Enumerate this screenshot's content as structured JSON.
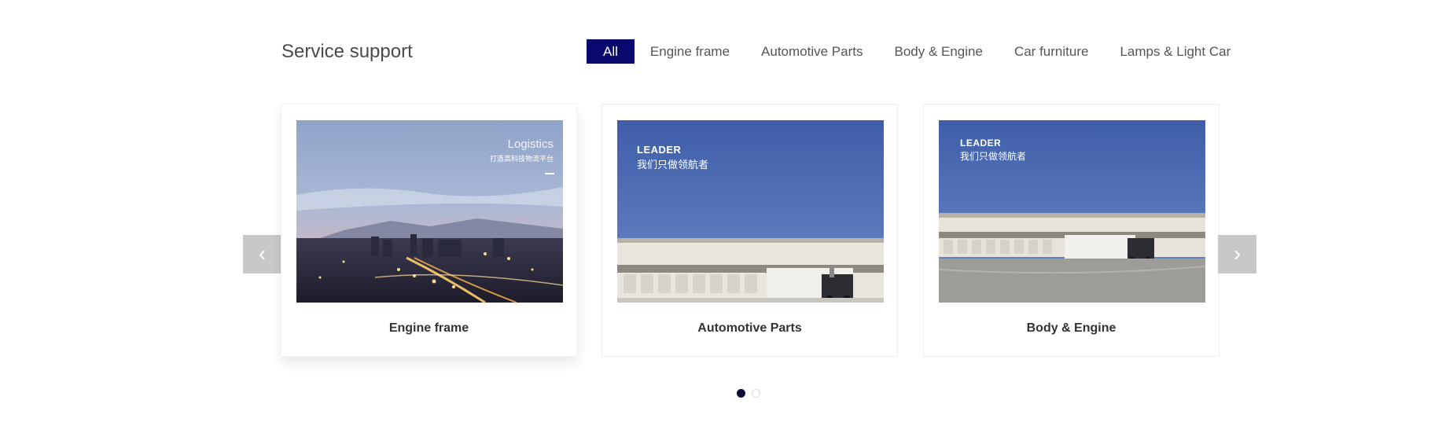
{
  "section": {
    "title": "Service support"
  },
  "tabs": [
    {
      "label": "All",
      "active": true
    },
    {
      "label": "Engine frame"
    },
    {
      "label": "Automotive Parts"
    },
    {
      "label": "Body & Engine"
    },
    {
      "label": "Car furniture"
    },
    {
      "label": "Lamps & Light Car"
    }
  ],
  "carousel": {
    "prev_icon": "‹",
    "next_icon": "›",
    "cards": [
      {
        "caption": "Engine frame",
        "image_title": "Logistics",
        "image_subtitle": "打造高科技物流平台"
      },
      {
        "caption": "Automotive Parts",
        "image_title": "LEADER",
        "image_subtitle": "我们只做领航者"
      },
      {
        "caption": "Body & Engine",
        "image_title": "LEADER",
        "image_subtitle": "我们只做领航者"
      }
    ],
    "page_count": 2,
    "active_page": 1
  },
  "colors": {
    "accent": "#0a0a6e",
    "arrow_bg": "#c8c8c8",
    "dot_active": "#0d0d3a"
  }
}
